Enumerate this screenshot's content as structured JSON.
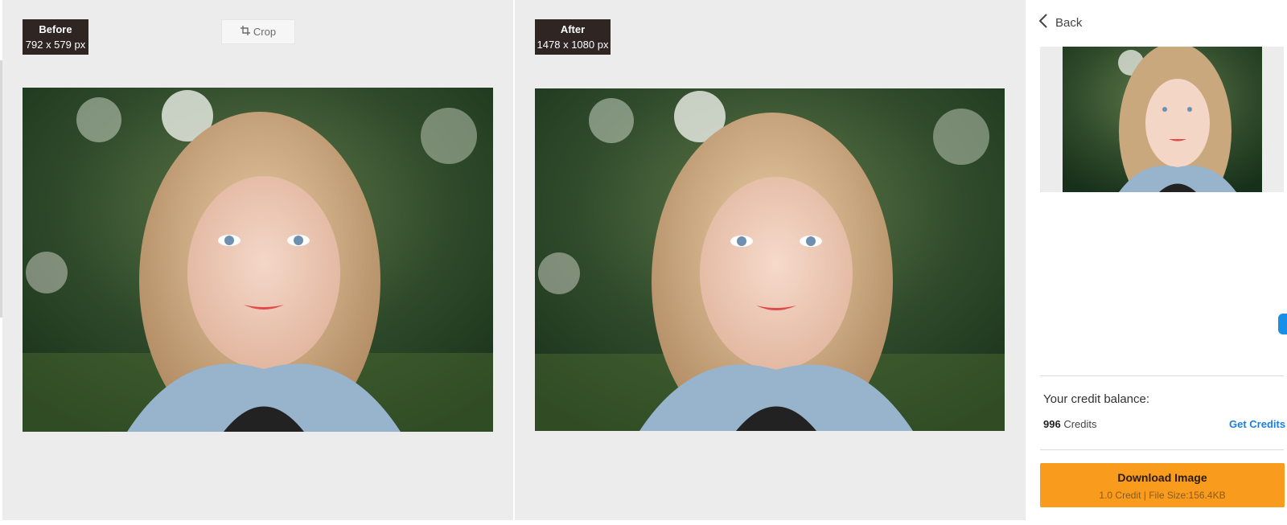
{
  "before": {
    "title": "Before",
    "dimensions": "792 x 579 px",
    "image_alt": "Before photo: girl with blonde hair"
  },
  "after": {
    "title": "After",
    "dimensions": "1478 x 1080 px",
    "image_alt": "After photo: girl with blonde hair"
  },
  "toolbar": {
    "crop_label": "Crop",
    "crop_icon": "crop-icon"
  },
  "sidebar": {
    "back_label": "Back",
    "back_icon": "chevron-left-icon",
    "credit_title": "Your credit balance:",
    "credit_amount": "996",
    "credit_unit": "Credits",
    "get_credits_label": "Get Credits",
    "download_label": "Download Image",
    "download_meta": "1.0 Credit | File Size:156.4KB"
  },
  "colors": {
    "accent": "#f99c1d",
    "link": "#1a7fe0",
    "badge_bg": "#2f2624",
    "panel_bg": "#ececec"
  }
}
